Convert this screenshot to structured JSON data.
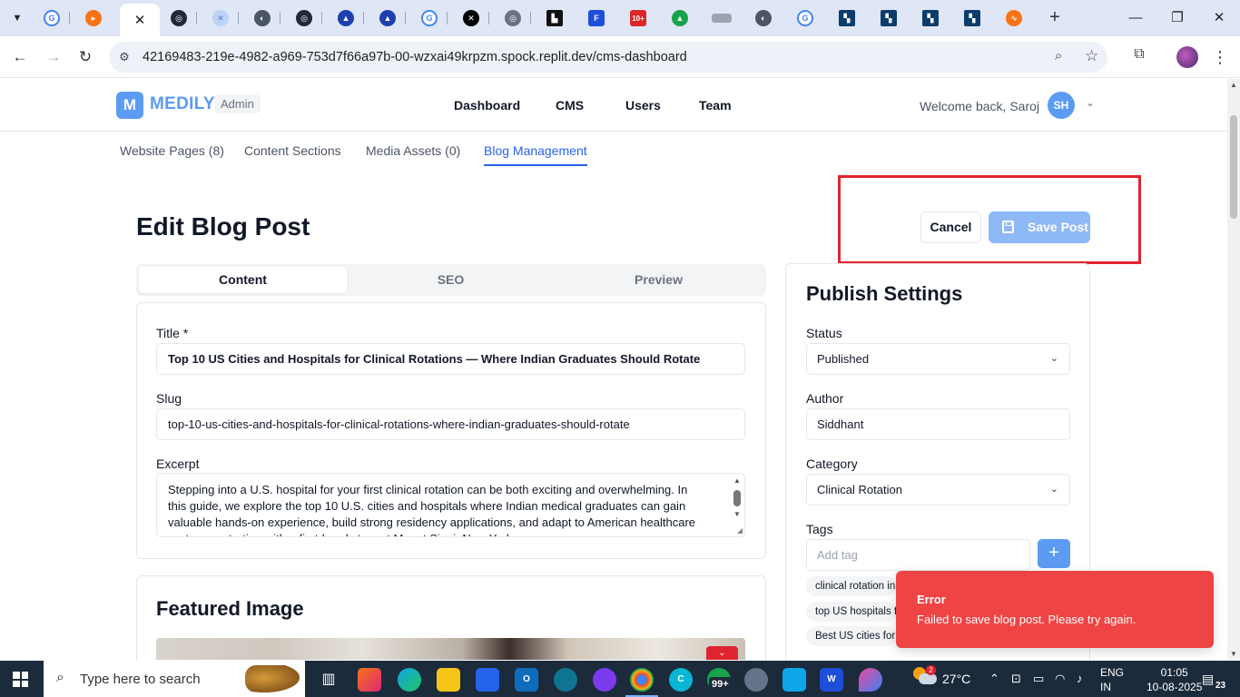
{
  "browser": {
    "url": "42169483-219e-4982-a969-753d7f66a97b-00-wzxai49krpzm.spock.replit.dev/cms-dashboard",
    "tab_close_icon": "close-icon",
    "new_tab": "+"
  },
  "app": {
    "logo_letter": "M",
    "brand": "MEDILY",
    "badge": "Admin",
    "nav": [
      "Dashboard",
      "CMS",
      "Users",
      "Team"
    ],
    "welcome": "Welcome back, Saroj",
    "avatar_initials": "SH"
  },
  "cms_tabs": [
    "Website Pages (8)",
    "Content Sections",
    "Media Assets (0)",
    "Blog Management"
  ],
  "active_cms_tab": "Blog Management",
  "page": {
    "title": "Edit Blog Post",
    "cancel_label": "Cancel",
    "save_label": "Save Post"
  },
  "editor_tabs": [
    "Content",
    "SEO",
    "Preview"
  ],
  "form": {
    "title_label": "Title *",
    "title_value": "Top 10 US Cities and Hospitals for Clinical Rotations — Where Indian Graduates Should Rotate",
    "slug_label": "Slug",
    "slug_value": "top-10-us-cities-and-hospitals-for-clinical-rotations-where-indian-graduates-should-rotate",
    "excerpt_label": "Excerpt",
    "excerpt_value": "Stepping into a U.S. hospital for your first clinical rotation can be both exciting and overwhelming. In this guide, we explore the top 10 U.S. cities and hospitals where Indian medical graduates can gain valuable hands-on experience, build strong residency applications, and adapt to American healthcare systems—starting with a first-hand story at Mount Sinai, New York."
  },
  "featured_image": {
    "title": "Featured Image"
  },
  "publish": {
    "title": "Publish Settings",
    "status_label": "Status",
    "status_value": "Published",
    "author_label": "Author",
    "author_value": "Siddhant",
    "category_label": "Category",
    "category_value": "Clinical Rotation",
    "tags_label": "Tags",
    "tag_placeholder": "Add tag",
    "tag_add": "+",
    "tags": [
      "clinical rotation in",
      "top US hospitals fo",
      "Best US cities for r"
    ]
  },
  "toast": {
    "title": "Error",
    "message": "Failed to save blog post. Please try again."
  },
  "taskbar": {
    "search_placeholder": "Type here to search",
    "badge": "99+",
    "weather_badge": "2",
    "temperature": "27°C",
    "lang_1": "ENG",
    "lang_2": "IN",
    "time": "01:05",
    "date": "10-08-2025",
    "notification_count": "23"
  },
  "colors": {
    "brand": "#5b9cf2",
    "active_tab": "#2563eb",
    "error": "#ef4444",
    "highlight": "#e0242f"
  }
}
